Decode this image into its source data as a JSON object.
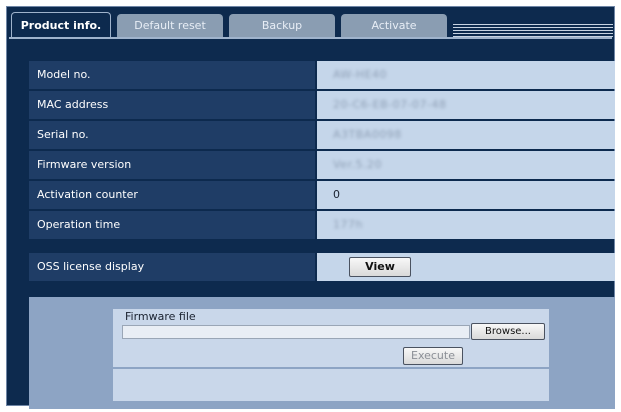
{
  "tabs": [
    {
      "label": "Product info.",
      "active": true
    },
    {
      "label": "Default reset",
      "active": false
    },
    {
      "label": "Backup",
      "active": false
    },
    {
      "label": "Activate",
      "active": false
    }
  ],
  "info_rows": [
    {
      "label": "Model no.",
      "value": "AW-HE40"
    },
    {
      "label": "MAC address",
      "value": "20-C6-EB-07-07-48"
    },
    {
      "label": "Serial no.",
      "value": "A3TBA0098"
    },
    {
      "label": "Firmware version",
      "value": "Ver.5.20"
    },
    {
      "label": "Activation counter",
      "value": "0"
    },
    {
      "label": "Operation time",
      "value": "177h"
    }
  ],
  "oss": {
    "label": "OSS license display",
    "button_label": "View"
  },
  "firmware": {
    "file_label": "Firmware file",
    "file_value": "",
    "browse_label": "Browse...",
    "execute_label": "Execute",
    "status_text": ""
  },
  "colors": {
    "background": "#0d2a4e",
    "label_cell": "#1f3d66",
    "value_cell": "#c5d6ea",
    "panel": "#8da4c4"
  }
}
